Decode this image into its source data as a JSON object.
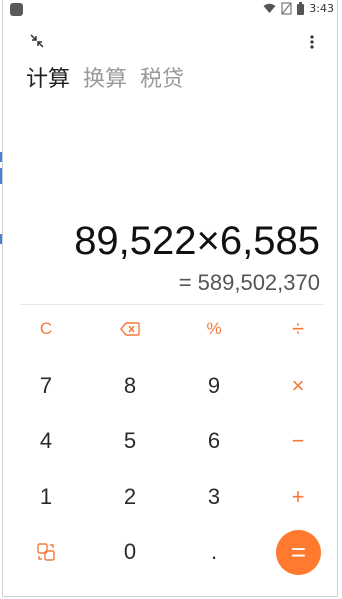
{
  "status_bar": {
    "time": "3:43"
  },
  "tabs": [
    {
      "label": "计算",
      "active": true
    },
    {
      "label": "换算",
      "active": false
    },
    {
      "label": "税贷",
      "active": false
    }
  ],
  "display": {
    "expression": "89,522×6,585",
    "result": "= 589,502,370"
  },
  "keypad": {
    "clear": "C",
    "backspace_icon": "backspace-icon",
    "percent": "%",
    "divide": "÷",
    "seven": "7",
    "eight": "8",
    "nine": "9",
    "multiply": "×",
    "four": "4",
    "five": "5",
    "six": "6",
    "subtract": "−",
    "one": "1",
    "two": "2",
    "three": "3",
    "add": "+",
    "mode_icon": "switch-mode-icon",
    "zero": "0",
    "dot": ".",
    "equals": "="
  },
  "colors": {
    "accent": "#ff7a2e",
    "operator": "#f47a3c",
    "active_tab": "#202020",
    "inactive_tab": "#9a9a9a"
  }
}
